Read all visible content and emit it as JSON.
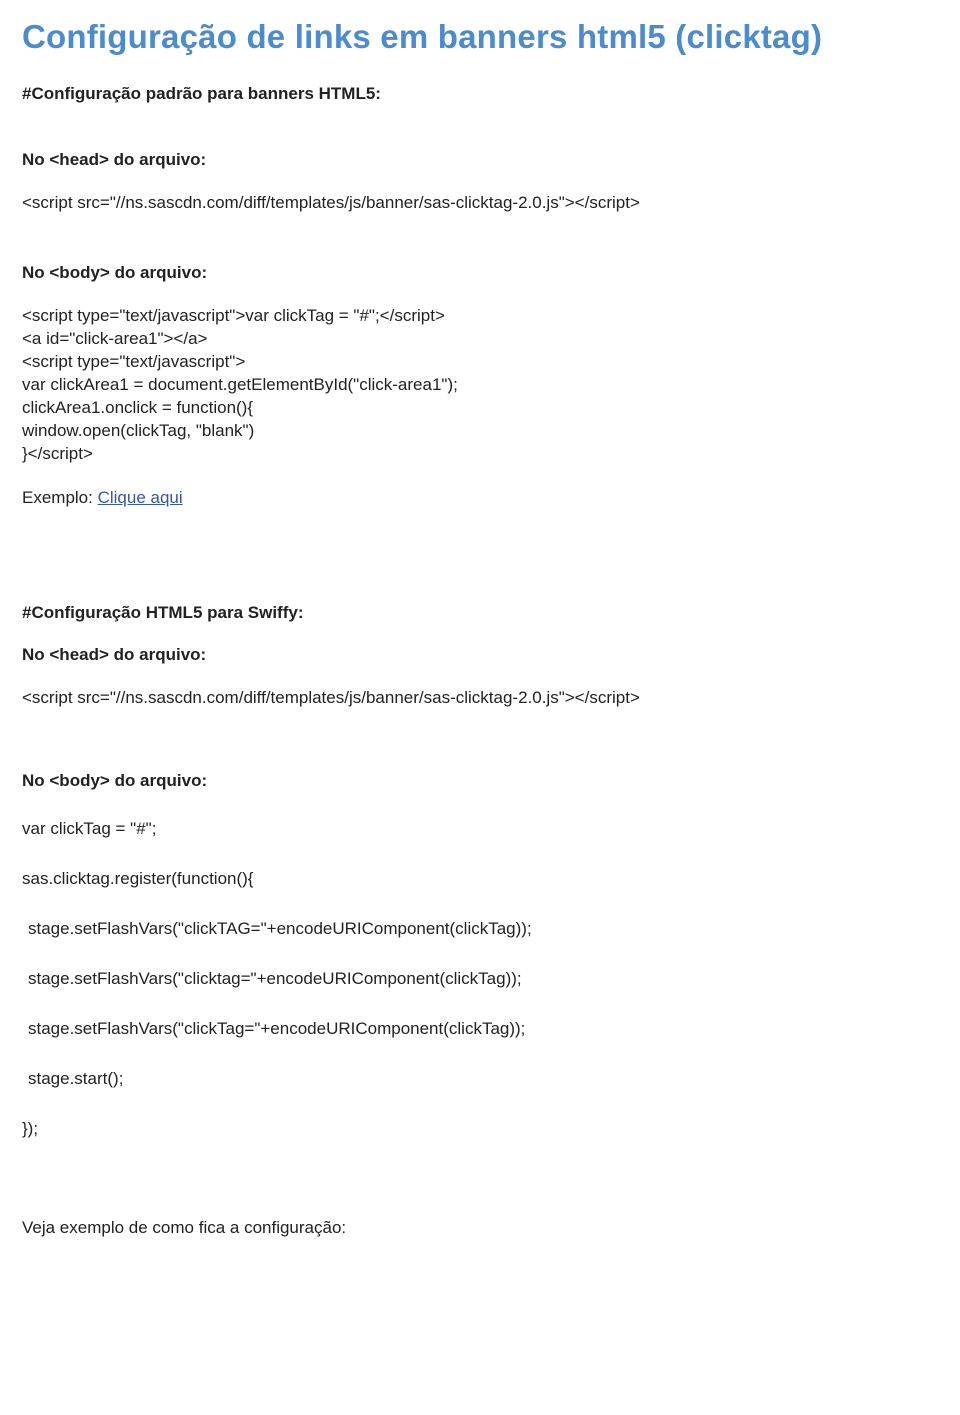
{
  "title": "Configuração de links em banners html5 (clicktag)",
  "section1": {
    "heading": "#Configuração padrão para banners HTML5:",
    "head_label": "No <head> do arquivo:",
    "head_code": "<script src=\"//ns.sascdn.com/diff/templates/js/banner/sas-clicktag-2.0.js\"></script>",
    "body_label": "No <body> do arquivo:",
    "body_code": "<script type=\"text/javascript\">var clickTag = \"#\";</script>\n<a id=\"click-area1\"></a>\n<script type=\"text/javascript\">\nvar clickArea1 = document.getElementById(\"click-area1\");\nclickArea1.onclick = function(){\nwindow.open(clickTag, \"blank\")\n}</script>",
    "exemplo_prefix": "Exemplo: ",
    "exemplo_link": "Clique aqui"
  },
  "section2": {
    "heading": "#Configuração HTML5 para Swiffy:",
    "head_label": "No <head> do arquivo:",
    "head_code": "<script src=\"//ns.sascdn.com/diff/templates/js/banner/sas-clicktag-2.0.js\"></script>",
    "body_label": "No <body> do arquivo:",
    "lines": {
      "l1": "var clickTag = \"#\";",
      "l2": "sas.clicktag.register(function(){",
      "l3": " stage.setFlashVars(\"clickTAG=\"+encodeURIComponent(clickTag));",
      "l4": " stage.setFlashVars(\"clicktag=\"+encodeURIComponent(clickTag));",
      "l5": " stage.setFlashVars(\"clickTag=\"+encodeURIComponent(clickTag));",
      "l6": " stage.start();",
      "l7": "});"
    },
    "footer": "Veja exemplo de como fica a configuração:"
  }
}
